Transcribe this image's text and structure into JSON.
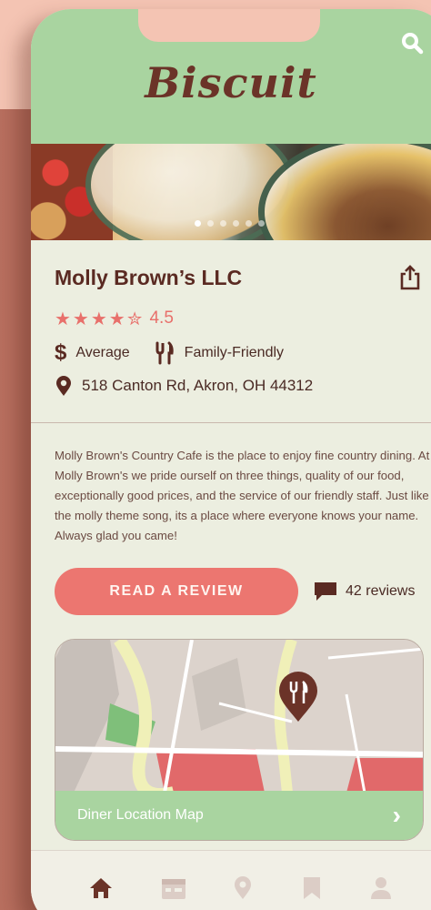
{
  "app": {
    "brand": "Biscuit"
  },
  "hero": {
    "slides": 6,
    "active_slide": 0
  },
  "restaurant": {
    "name": "Molly Brown’s LLC",
    "rating_stars": "★★★★✮",
    "rating_value": "4.5",
    "price": "Average",
    "category": "Family-Friendly",
    "address": "518 Canton Rd, Akron, OH 44312",
    "description": "Molly Brown's Country Cafe is the place to enjoy fine country dining. At Molly Brown's we pride ourself on three things, quality of our food, exceptionally good prices, and the service of our friendly staff. Just like the molly theme song, its a place where everyone knows your name. Always glad you came!"
  },
  "actions": {
    "read_review_label": "READ A REVIEW",
    "review_count_label": "42 reviews"
  },
  "map": {
    "label": "Diner Location Map",
    "chevron": "›"
  },
  "tabs": [
    {
      "name": "home",
      "icon": "home-icon",
      "active": true
    },
    {
      "name": "menu",
      "icon": "calendar-icon",
      "active": false
    },
    {
      "name": "location",
      "icon": "location-pin-icon",
      "active": false
    },
    {
      "name": "saved",
      "icon": "bookmark-icon",
      "active": false
    },
    {
      "name": "profile",
      "icon": "user-icon",
      "active": false
    }
  ],
  "colors": {
    "header_green": "#a9d4a0",
    "accent_coral": "#ec7670",
    "text_brown": "#5a2a22",
    "background": "#eceee0"
  }
}
